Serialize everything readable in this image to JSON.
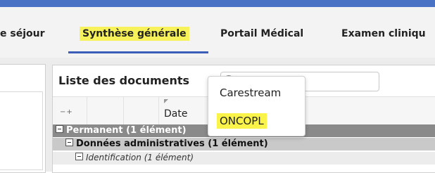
{
  "tabs": [
    {
      "label": "e séjour"
    },
    {
      "label": "Synthèse générale",
      "active": true
    },
    {
      "label": "Portail Médical"
    },
    {
      "label": "Examen cliniqu"
    }
  ],
  "colors": {
    "accent": "#4a72c4",
    "highlight": "#f9f34a",
    "active_underline": "#3b5fb8"
  },
  "documents": {
    "title": "Liste des documents",
    "search_value": "",
    "columns": [
      "Date"
    ],
    "expand_collapse": "−+",
    "groups": [
      {
        "label": "Permanent",
        "count": "(1 élément)"
      },
      {
        "label": "Données administratives",
        "count": "(1 élément)"
      },
      {
        "label": "Identification",
        "count": "(1 élément)"
      }
    ]
  },
  "popup_menu": {
    "items": [
      "Carestream",
      "ONCOPL"
    ]
  }
}
